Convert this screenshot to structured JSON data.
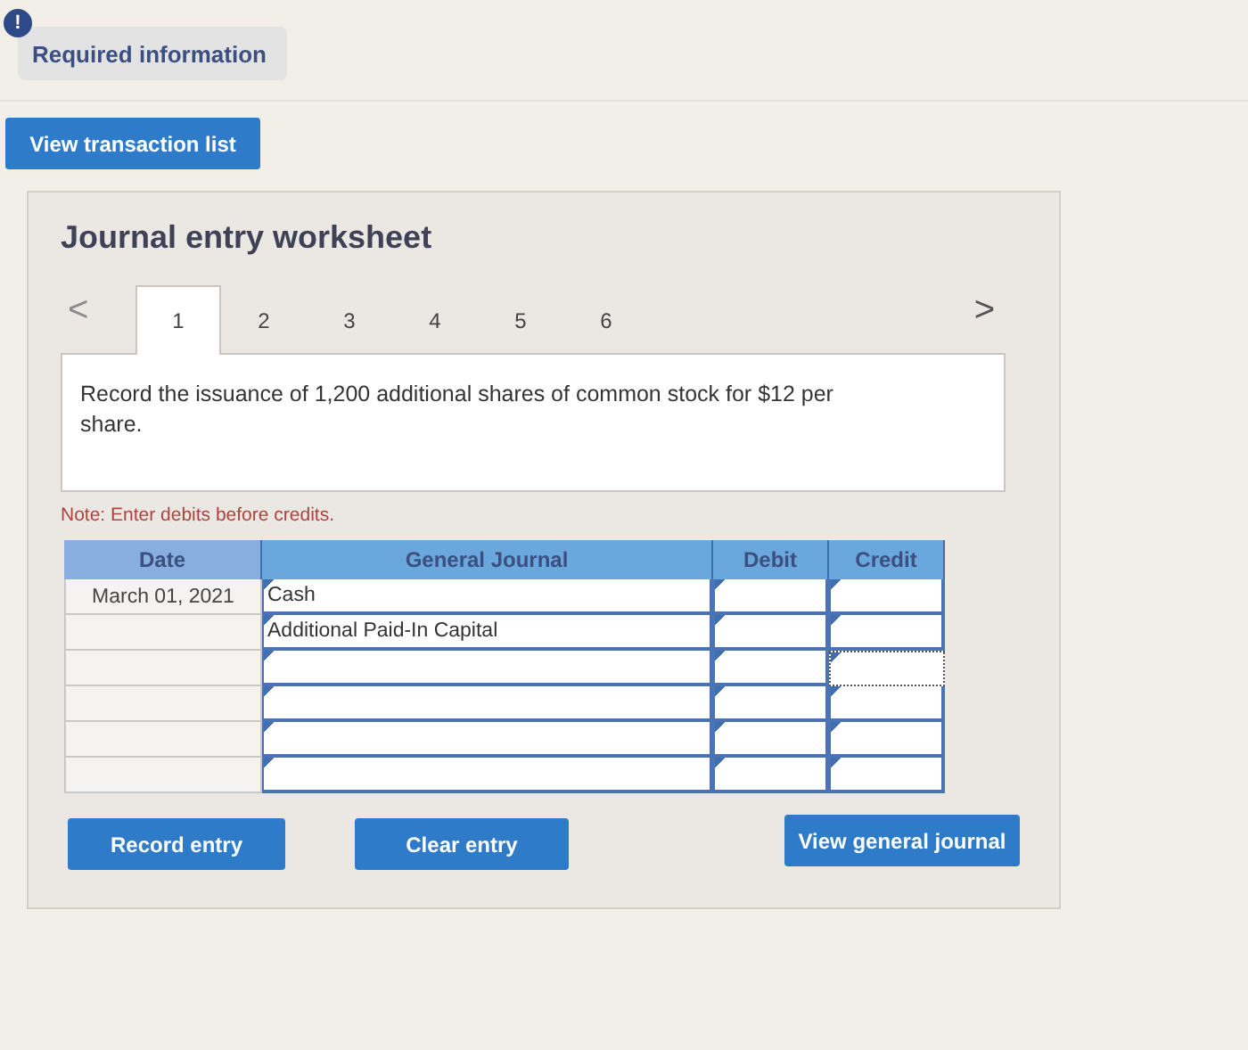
{
  "alert": {
    "icon": "!",
    "label": "Required information"
  },
  "transactions_button": "View transaction list",
  "worksheet": {
    "title": "Journal entry worksheet",
    "prev": "<",
    "next": ">",
    "tabs": [
      {
        "label": "1",
        "selected": true
      },
      {
        "label": "2",
        "selected": false
      },
      {
        "label": "3",
        "selected": false
      },
      {
        "label": "4",
        "selected": false
      },
      {
        "label": "5",
        "selected": false
      },
      {
        "label": "6",
        "selected": false
      }
    ],
    "instruction": "Record the issuance of 1,200 additional shares of common stock for $12 per share.",
    "note": "Note: Enter debits before credits.",
    "table": {
      "columns": [
        "Date",
        "General Journal",
        "Debit",
        "Credit"
      ],
      "rows": [
        {
          "date": "March 01, 2021",
          "account": "Cash",
          "credit_focused": false
        },
        {
          "account": "Additional Paid-In Capital",
          "credit_focused": false
        },
        {
          "credit_focused": true
        },
        {
          "credit_focused": false
        },
        {
          "credit_focused": false
        },
        {
          "credit_focused": false
        }
      ]
    },
    "buttons": [
      "Record entry",
      "Clear entry",
      "View general journal"
    ]
  }
}
